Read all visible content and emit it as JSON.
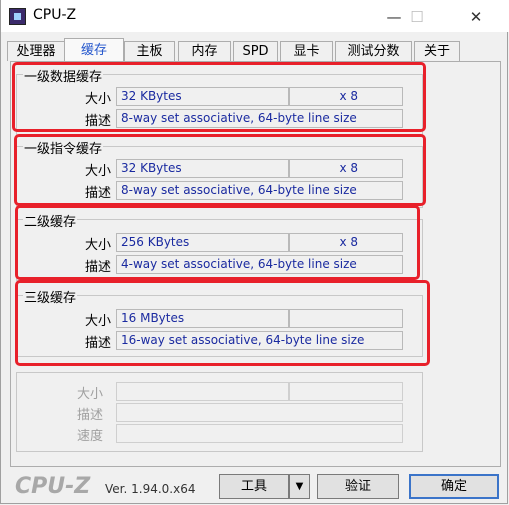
{
  "window": {
    "title": "CPU-Z",
    "minimize": "—",
    "maximize": "☐",
    "close": "✕"
  },
  "tabs": [
    {
      "label": "处理器"
    },
    {
      "label": "缓存"
    },
    {
      "label": "主板"
    },
    {
      "label": "内存"
    },
    {
      "label": "SPD"
    },
    {
      "label": "显卡"
    },
    {
      "label": "测试分数"
    },
    {
      "label": "关于"
    }
  ],
  "labels": {
    "size": "大小",
    "desc": "描述",
    "speed": "速度"
  },
  "caches": [
    {
      "title": "一级数据缓存",
      "size": "32 KBytes",
      "count": "x 8",
      "desc": "8-way set associative, 64-byte line size"
    },
    {
      "title": "一级指令缓存",
      "size": "32 KBytes",
      "count": "x 8",
      "desc": "8-way set associative, 64-byte line size"
    },
    {
      "title": "二级缓存",
      "size": "256 KBytes",
      "count": "x 8",
      "desc": "4-way set associative, 64-byte line size"
    },
    {
      "title": "三级缓存",
      "size": "16 MBytes",
      "count": "",
      "desc": "16-way set associative, 64-byte line size"
    }
  ],
  "footer": {
    "logo": "CPU-Z",
    "version": "Ver. 1.94.0.x64",
    "tools": "工具",
    "dropdown": "▼",
    "validate": "验证",
    "ok": "确定"
  },
  "colors": {
    "highlight": "#e8202a",
    "value_text": "#1a2aa0",
    "active_tab": "#2255cc"
  }
}
